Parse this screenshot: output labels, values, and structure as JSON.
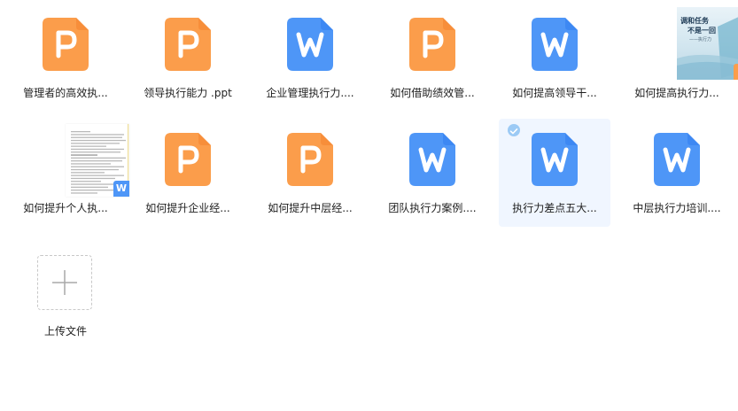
{
  "colors": {
    "ppt": "#fb9d4b",
    "ppt_dark": "#f4812e",
    "doc": "#4e96f7",
    "doc_dark": "#2f7ef0",
    "selected_bg": "#f0f6ff",
    "check": "#9ccaf5"
  },
  "files": [
    {
      "name": "管理者的高效执...",
      "type": "ppt",
      "icon": "ppt-file-icon"
    },
    {
      "name": "领导执行能力 .ppt",
      "type": "ppt",
      "icon": "ppt-file-icon"
    },
    {
      "name": "企业管理执行力....",
      "type": "doc",
      "icon": "word-file-icon"
    },
    {
      "name": "如何借助绩效管...",
      "type": "ppt",
      "icon": "ppt-file-icon"
    },
    {
      "name": "如何提高领导干...",
      "type": "doc",
      "icon": "word-file-icon"
    },
    {
      "name": "如何提高执行力...",
      "type": "ppt-thumbnail",
      "icon": "ppt-thumbnail-icon",
      "thumb_lines": [
        "调和任务",
        "不是一回",
        "——执行力"
      ]
    },
    {
      "name": "如何提升个人执...",
      "type": "doc-thumbnail",
      "icon": "word-thumbnail-icon"
    },
    {
      "name": "如何提升企业经...",
      "type": "ppt",
      "icon": "ppt-file-icon"
    },
    {
      "name": "如何提升中层经...",
      "type": "ppt",
      "icon": "ppt-file-icon"
    },
    {
      "name": "团队执行力案例....",
      "type": "doc",
      "icon": "word-file-icon"
    },
    {
      "name": "执行力差点五大...",
      "type": "doc",
      "icon": "word-file-icon",
      "selected": true
    },
    {
      "name": "中层执行力培训....",
      "type": "doc",
      "icon": "word-file-icon"
    }
  ],
  "upload": {
    "label": "上传文件",
    "icon": "plus-icon"
  }
}
